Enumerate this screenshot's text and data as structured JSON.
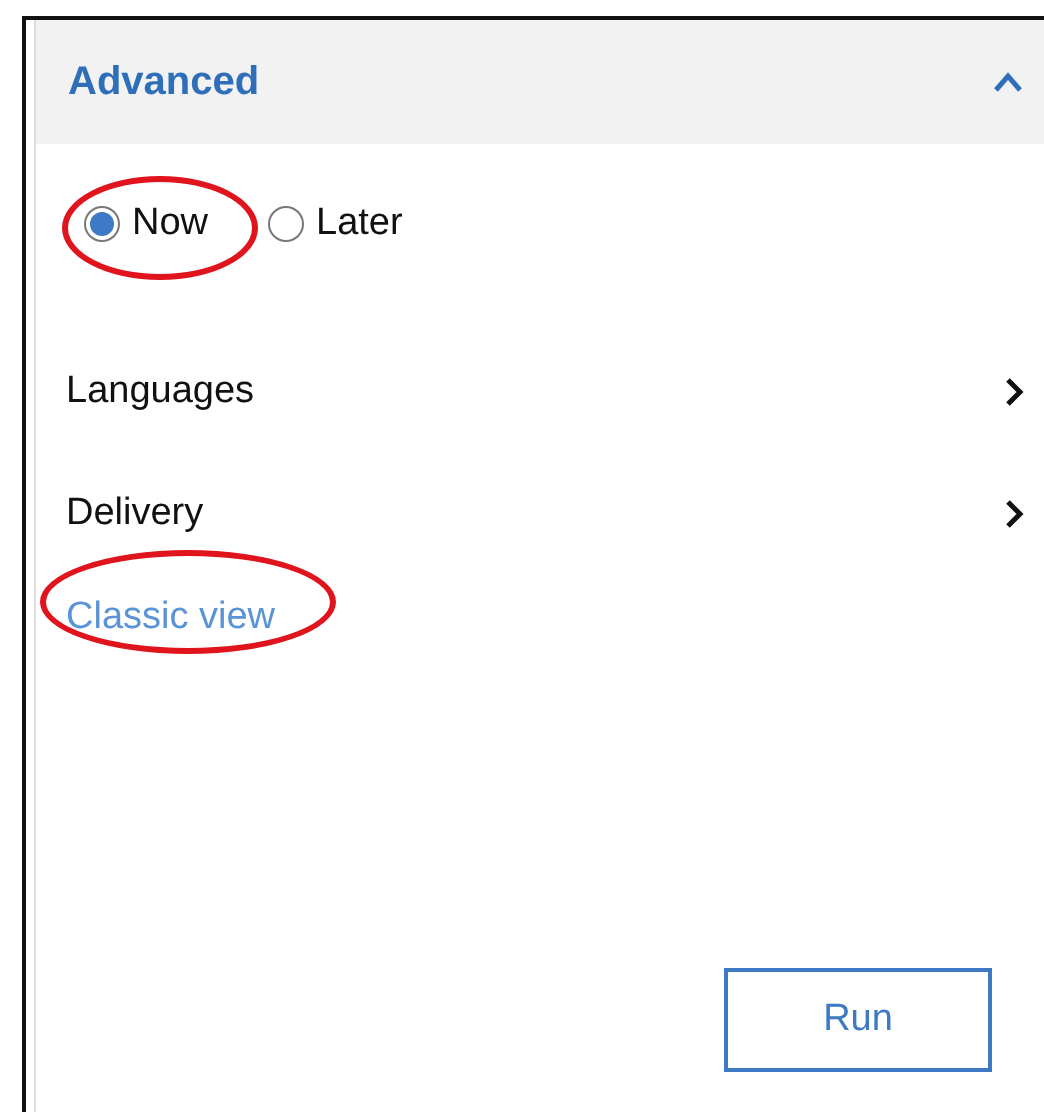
{
  "section": {
    "title": "Advanced",
    "expanded": true
  },
  "schedule": [
    {
      "label": "Now",
      "selected": true,
      "highlighted": true
    },
    {
      "label": "Later",
      "selected": false,
      "highlighted": false
    }
  ],
  "options": [
    {
      "label": "Languages"
    },
    {
      "label": "Delivery"
    }
  ],
  "link": {
    "label": "Classic view",
    "highlighted": true
  },
  "buttons": [
    "Run"
  ]
}
